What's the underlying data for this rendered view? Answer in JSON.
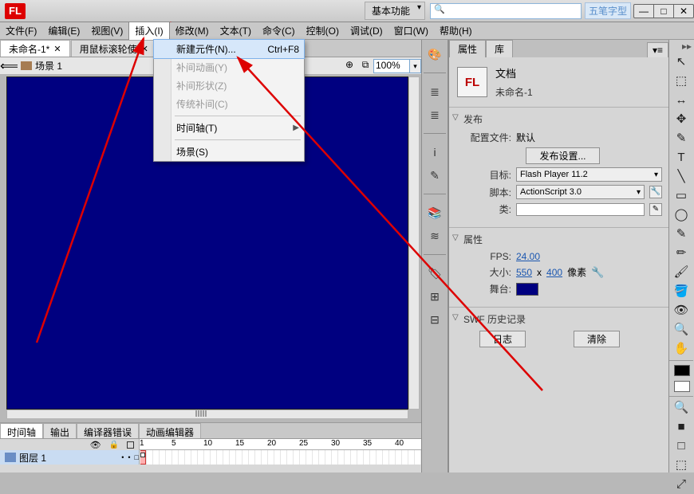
{
  "title": {
    "logo": "FL",
    "workspace": "基本功能",
    "ime": "五笔字型"
  },
  "winbtns": {
    "min": "—",
    "max": "□",
    "close": "✕"
  },
  "menus": [
    "文件(F)",
    "编辑(E)",
    "视图(V)",
    "插入(I)",
    "修改(M)",
    "文本(T)",
    "命令(C)",
    "控制(O)",
    "调试(D)",
    "窗口(W)",
    "帮助(H)"
  ],
  "menu_active_index": 3,
  "dropdown": {
    "items": [
      {
        "label": "新建元件(N)...",
        "shortcut": "Ctrl+F8",
        "hl": true
      },
      {
        "label": "补间动画(Y)",
        "dis": true
      },
      {
        "label": "补间形状(Z)",
        "dis": true
      },
      {
        "label": "传统补间(C)",
        "dis": true
      },
      {
        "sep": true
      },
      {
        "label": "时间轴(T)",
        "arrow": true
      },
      {
        "sep": true
      },
      {
        "label": "场景(S)"
      }
    ]
  },
  "doctabs": [
    {
      "label": "未命名-1*",
      "active": true
    },
    {
      "label": "用鼠标滚轮使"
    }
  ],
  "scene": {
    "label": "场景 1",
    "zoom": "100%",
    "zoom_icon1": "⊕",
    "zoom_icon2": "⧉"
  },
  "timeline": {
    "tabs": [
      "时间轴",
      "输出",
      "编译器错误",
      "动画编辑器"
    ],
    "layer": "图层 1",
    "marks": [
      "1",
      "5",
      "10",
      "15",
      "20",
      "25",
      "30",
      "35",
      "40"
    ]
  },
  "midcol": [
    "🎨",
    "≣",
    "≣",
    "i",
    "✎",
    "📚",
    "≋",
    "🏷",
    "⊞",
    "⊟"
  ],
  "props": {
    "tabs": [
      "属性",
      "库"
    ],
    "doc_type": "文档",
    "doc_name": "未命名-1",
    "publish_section": "发布",
    "config_label": "配置文件:",
    "config_val": "默认",
    "pub_settings": "发布设置...",
    "target_label": "目标:",
    "target_val": "Flash Player 11.2",
    "script_label": "脚本:",
    "script_val": "ActionScript 3.0",
    "class_label": "类:",
    "properties_section": "属性",
    "fps_label": "FPS:",
    "fps_val": "24.00",
    "size_label": "大小:",
    "w": "550",
    "h": "400",
    "x": "x",
    "px": "像素",
    "stage_label": "舞台:",
    "swf_section": "SWF 历史记录",
    "log": "日志",
    "clear": "清除"
  },
  "tools": [
    "↖",
    "⬚",
    "↔",
    "✥",
    "✎",
    "T",
    "╲",
    "▭",
    "◯",
    "✎",
    "✏",
    "🖌",
    "🪣",
    "👁",
    "🔍",
    "✋",
    "🔍",
    "■",
    "□",
    "⬚",
    "⤢"
  ]
}
